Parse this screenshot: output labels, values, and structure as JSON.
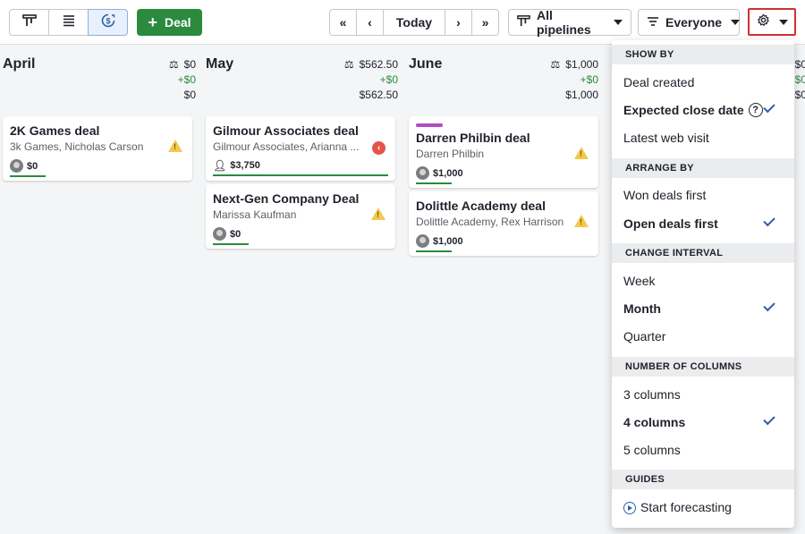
{
  "toolbar": {
    "views": [
      {
        "name": "pipeline-view-icon",
        "active": false
      },
      {
        "name": "list-view-icon",
        "active": false
      },
      {
        "name": "forecast-view-icon",
        "active": true
      }
    ],
    "add_deal_label": "Deal",
    "nav": {
      "today_label": "Today"
    },
    "pipelines_label": "All pipelines",
    "owner_filter_label": "Everyone"
  },
  "columns": [
    {
      "title": "April",
      "total": "$0",
      "won": "+$0",
      "sum": "$0"
    },
    {
      "title": "May",
      "total": "$562.50",
      "won": "+$0",
      "sum": "$562.50"
    },
    {
      "title": "June",
      "total": "$1,000",
      "won": "+$0",
      "sum": "$1,000"
    },
    {
      "title": "",
      "total": "$0",
      "won": "+$0",
      "sum": "$0"
    }
  ],
  "cards": [
    {
      "title": "2K Games deal",
      "subtitle": "3k Games, Nicholas Carson",
      "value": "$0"
    },
    {
      "title": "Gilmour Associates deal",
      "subtitle": "Gilmour Associates, Arianna ...",
      "value": "$3,750"
    },
    {
      "title": "Next-Gen Company Deal",
      "subtitle": "Marissa Kaufman",
      "value": "$0"
    },
    {
      "title": "Darren Philbin deal",
      "subtitle": "Darren Philbin",
      "value": "$1,000"
    },
    {
      "title": "Dolittle Academy deal",
      "subtitle": "Dolittle Academy, Rex Harrison",
      "value": "$1,000"
    }
  ],
  "menu": {
    "show_by": {
      "header": "SHOW BY",
      "items": [
        "Deal created",
        "Expected close date",
        "Latest web visit"
      ],
      "selected": 1
    },
    "arrange_by": {
      "header": "ARRANGE BY",
      "items": [
        "Won deals first",
        "Open deals first"
      ],
      "selected": 1
    },
    "change_interval": {
      "header": "CHANGE INTERVAL",
      "items": [
        "Week",
        "Month",
        "Quarter"
      ],
      "selected": 1
    },
    "columns": {
      "header": "NUMBER OF COLUMNS",
      "items": [
        "3 columns",
        "4 columns",
        "5 columns"
      ],
      "selected": 1
    },
    "guides": {
      "header": "GUIDES",
      "items": [
        "Start forecasting"
      ]
    }
  },
  "colors": {
    "primary_green": "#2b8a3e",
    "accent_blue": "#2e5fa8",
    "highlight_red": "#d32f2f",
    "warning_yellow": "#f2c94c"
  }
}
